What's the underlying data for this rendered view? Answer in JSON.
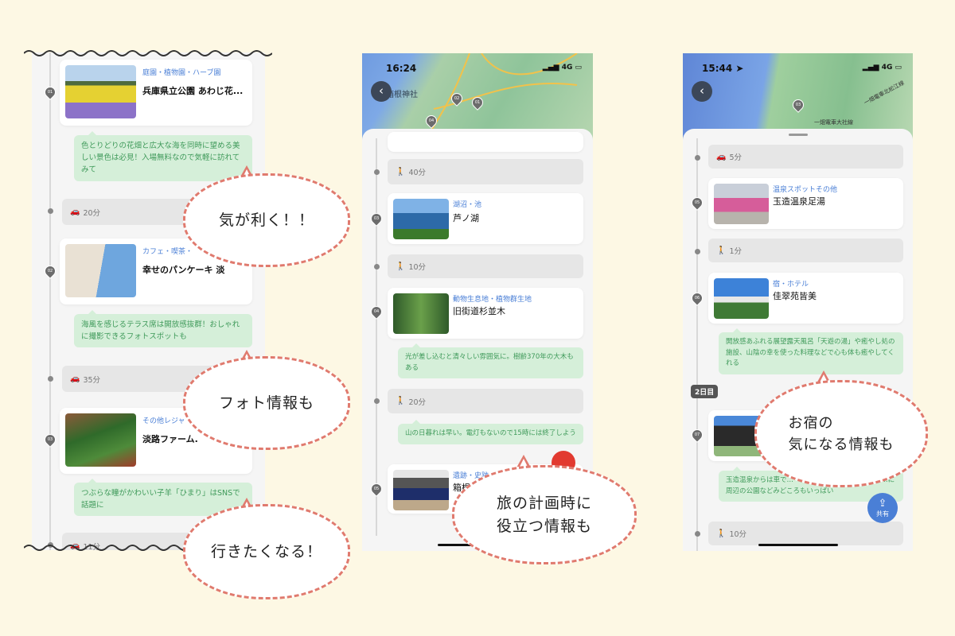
{
  "left": {
    "items": [
      {
        "num": "01",
        "category": "庭園・植物園・ハーブ園",
        "title": "兵庫県立公園 あわじ花...",
        "note": "色とりどりの花畑と広大な海を同時に望める美しい景色は必見！入場無料なので気軽に訪れてみて",
        "transit": "20分",
        "transit_icon": "car-icon"
      },
      {
        "num": "02",
        "category": "カフェ・喫茶・",
        "title": "幸せのパンケーキ 淡",
        "note": "海風を感じるテラス席は開放感抜群！おしゃれに撮影できるフォトスポットも",
        "transit": "35分",
        "transit_icon": "car-icon"
      },
      {
        "num": "03",
        "category": "その他レジャ",
        "title": "淡路ファーム.",
        "note": "つぶらな瞳がかわいい子羊「ひまり」はSNSで話題に",
        "transit": "11分",
        "transit_icon": "car-icon"
      }
    ]
  },
  "middle": {
    "time": "16:24",
    "network": "4G",
    "map_label": "箱根神社",
    "map_pins": [
      "02",
      "01",
      "04"
    ],
    "transits": [
      "40分",
      "10分",
      "20分"
    ],
    "items": [
      {
        "num": "03",
        "category": "湖沼・池",
        "title": "芦ノ湖"
      },
      {
        "num": "04",
        "category": "動物生息地・植物群生地",
        "title": "旧街道杉並木",
        "note": "光が差し込むと清々しい雰囲気に。樹齢370年の大木もある"
      },
      {
        "num": "05",
        "category": "遺跡・史跡",
        "title": "箱根"
      }
    ],
    "note2": "山の日暮れは早い。電灯もないので15時には終了しよう"
  },
  "right": {
    "time": "15:44",
    "network": "4G",
    "map_label1": "一畑電車大社線",
    "map_label2": "一畑電車北松江線",
    "map_pin": "03",
    "transits": [
      "5分",
      "1分",
      "10分"
    ],
    "items": [
      {
        "num": "05",
        "category": "温泉スポットその他",
        "title": "玉造温泉足湯"
      },
      {
        "num": "06",
        "category": "宿・ホテル",
        "title": "佳翠苑皆美",
        "note": "開放感あふれる展望露天風呂「天遊の湯」や癒やし処の施設、山陰の幸を使った料理などで心も体も癒やしてくれる"
      },
      {
        "num": "07",
        "note": "玉造温泉からは車で…一望できる絶好のスポット。…に周辺の公園などみどころもいっぱい"
      }
    ],
    "day_badge": "2日目",
    "share_label": "共有"
  },
  "bubbles": [
    "気が利く！！",
    "フォト情報も",
    "行きたくなる！",
    "旅の計画時に\n役立つ情報も",
    "お宿の\n気になる情報も"
  ],
  "colors": {
    "background": "#fdf8e4",
    "accent": "#4a7fd6",
    "note_bg": "#d5efd9",
    "bubble_border": "#e07a6e"
  }
}
